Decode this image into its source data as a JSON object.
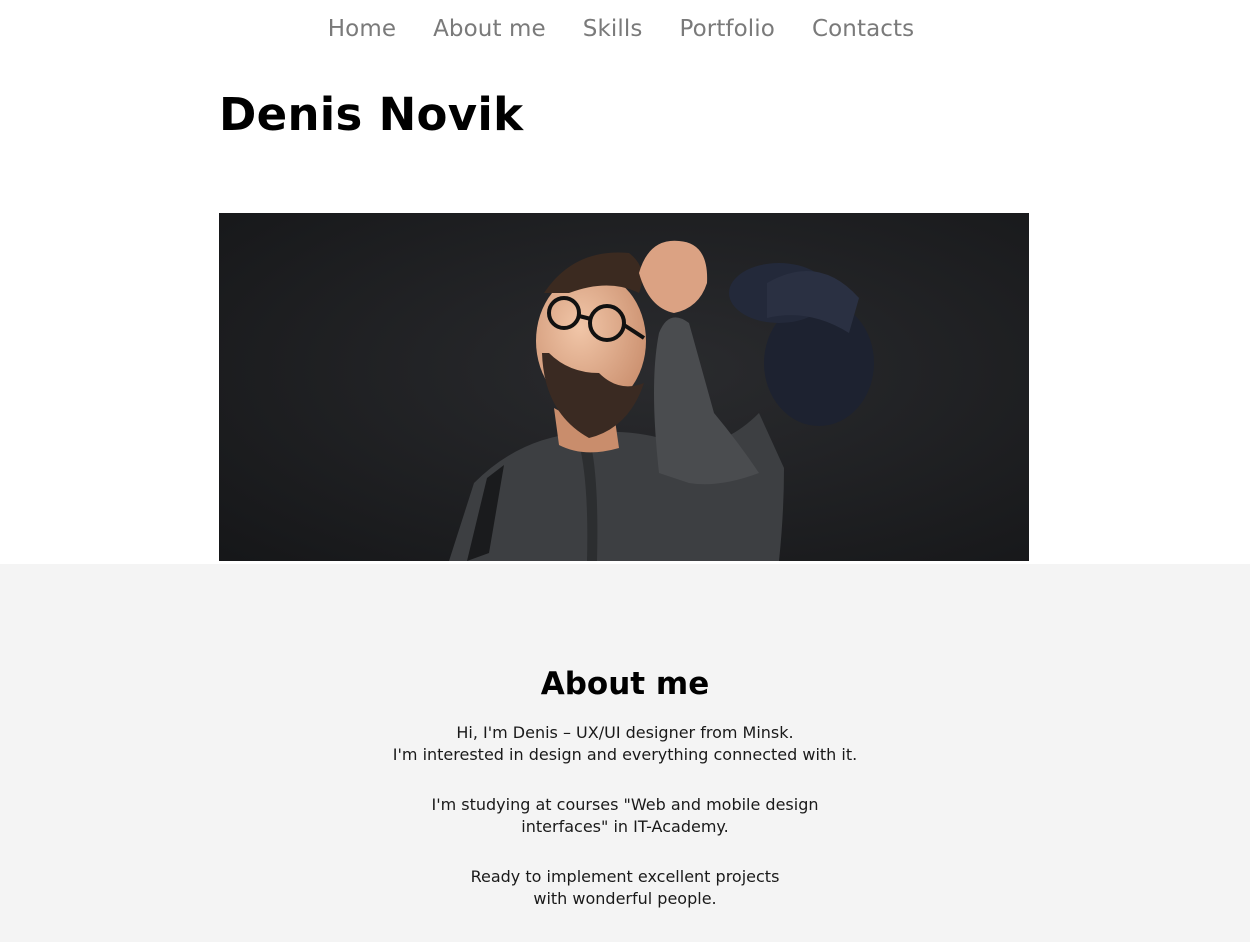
{
  "nav": {
    "items": [
      {
        "label": "Home"
      },
      {
        "label": "About me"
      },
      {
        "label": "Skills"
      },
      {
        "label": "Portfolio"
      },
      {
        "label": "Contacts"
      }
    ]
  },
  "hero": {
    "name": "Denis Novik"
  },
  "about": {
    "title": "About me",
    "paragraphs": [
      [
        "Hi, I'm Denis – UX/UI designer from Minsk.",
        "I'm interested in design and everything connected with it."
      ],
      [
        "I'm studying at courses \"Web and mobile design",
        "interfaces\" in IT-Academy."
      ],
      [
        "Ready to implement excellent projects",
        "with wonderful people."
      ]
    ]
  },
  "colors": {
    "nav_text": "#7a7a7a",
    "about_background": "#f4f4f4",
    "photo_background": "#1e1f21"
  }
}
